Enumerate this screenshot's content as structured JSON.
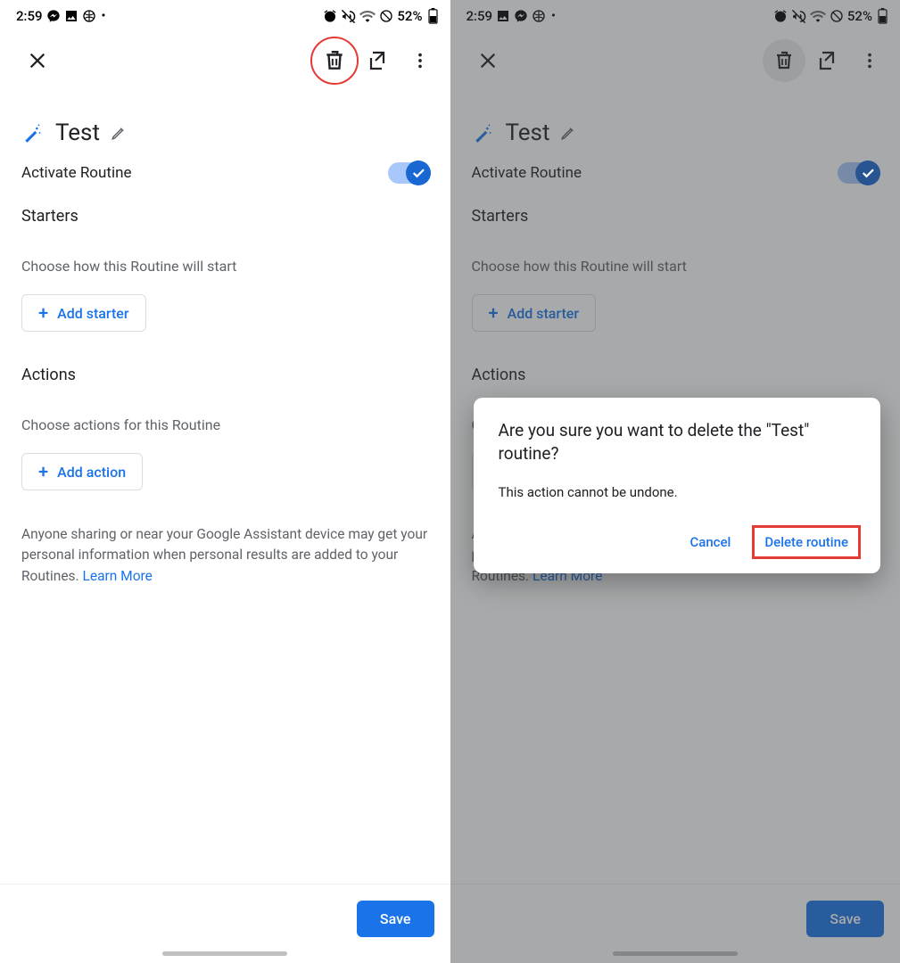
{
  "status": {
    "time": "2:59",
    "battery_text": "52%"
  },
  "app_bar": {
    "close": "Close",
    "delete": "Delete",
    "shortcut": "Shortcut",
    "more": "More"
  },
  "routine": {
    "name": "Test",
    "activate_label": "Activate Routine",
    "starters_label": "Starters",
    "starters_subtext": "Choose how this Routine will start",
    "add_starter": "Add starter",
    "actions_label": "Actions",
    "actions_subtext": "Choose actions for this Routine",
    "add_action": "Add action",
    "disclosure_text": "Anyone sharing or near your Google Assistant device may get your personal information when personal results are added to your Routines. ",
    "learn_more": "Learn More",
    "save": "Save"
  },
  "dialog": {
    "title": "Are you sure you want to delete the \"Test\" routine?",
    "body": "This action cannot be undone.",
    "cancel": "Cancel",
    "delete": "Delete routine"
  }
}
